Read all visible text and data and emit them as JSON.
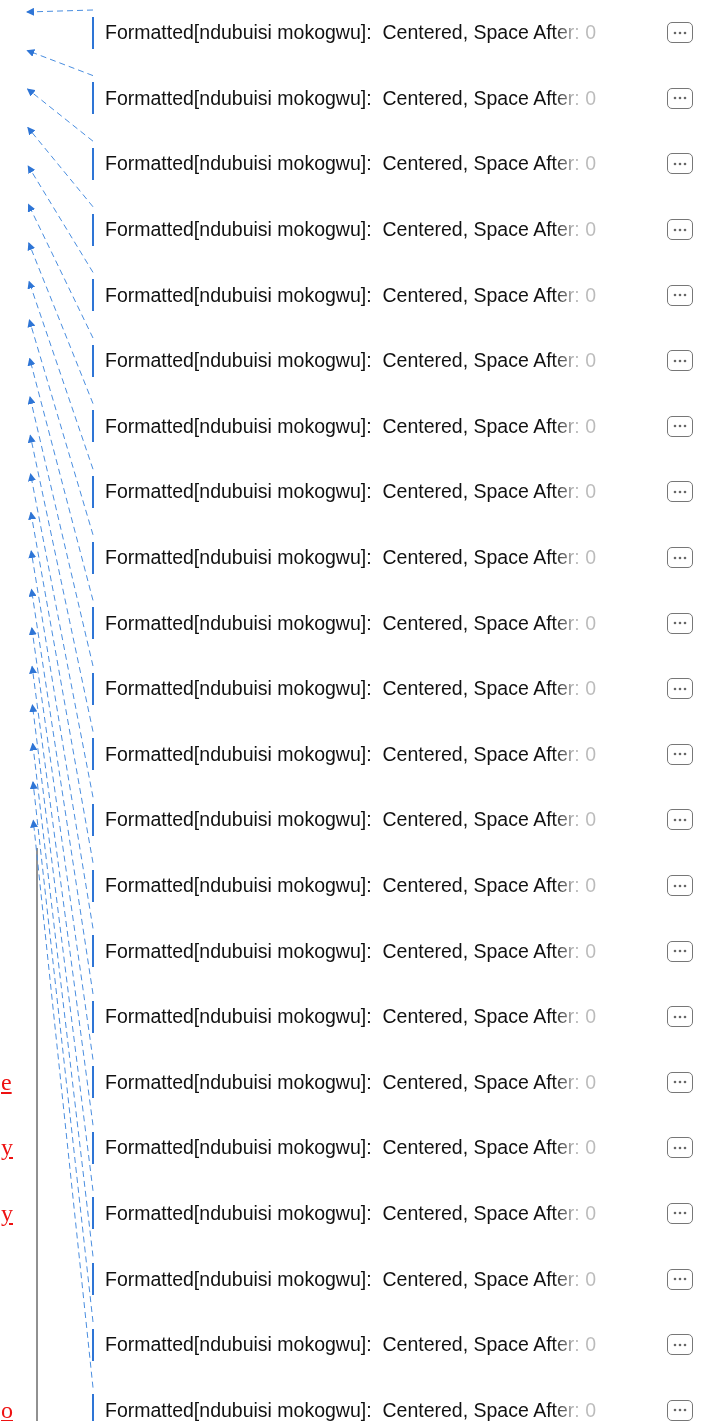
{
  "comments": [
    {
      "label": "Formatted[ndubuisi mokogwu]:",
      "detail": "Centered, Space After: 0"
    },
    {
      "label": "Formatted[ndubuisi mokogwu]:",
      "detail": "Centered, Space After: 0"
    },
    {
      "label": "Formatted[ndubuisi mokogwu]:",
      "detail": "Centered, Space After: 0"
    },
    {
      "label": "Formatted[ndubuisi mokogwu]:",
      "detail": "Centered, Space After: 0"
    },
    {
      "label": "Formatted[ndubuisi mokogwu]:",
      "detail": "Centered, Space After: 0"
    },
    {
      "label": "Formatted[ndubuisi mokogwu]:",
      "detail": "Centered, Space After: 0"
    },
    {
      "label": "Formatted[ndubuisi mokogwu]:",
      "detail": "Centered, Space After: 0"
    },
    {
      "label": "Formatted[ndubuisi mokogwu]:",
      "detail": "Centered, Space After: 0"
    },
    {
      "label": "Formatted[ndubuisi mokogwu]:",
      "detail": "Centered, Space After: 0"
    },
    {
      "label": "Formatted[ndubuisi mokogwu]:",
      "detail": "Centered, Space After: 0"
    },
    {
      "label": "Formatted[ndubuisi mokogwu]:",
      "detail": "Centered, Space After: 0"
    },
    {
      "label": "Formatted[ndubuisi mokogwu]:",
      "detail": "Centered, Space After: 0"
    },
    {
      "label": "Formatted[ndubuisi mokogwu]:",
      "detail": "Centered, Space After: 0"
    },
    {
      "label": "Formatted[ndubuisi mokogwu]:",
      "detail": "Centered, Space After: 0"
    },
    {
      "label": "Formatted[ndubuisi mokogwu]:",
      "detail": "Centered, Space After: 0"
    },
    {
      "label": "Formatted[ndubuisi mokogwu]:",
      "detail": "Centered, Space After: 0"
    },
    {
      "label": "Formatted[ndubuisi mokogwu]:",
      "detail": "Centered, Space After: 0",
      "document_text": "e"
    },
    {
      "label": "Formatted[ndubuisi mokogwu]:",
      "detail": "Centered, Space After: 0",
      "document_text": "y"
    },
    {
      "label": "Formatted[ndubuisi mokogwu]:",
      "detail": "Centered, Space After: 0",
      "document_text": "y"
    },
    {
      "label": "Formatted[ndubuisi mokogwu]:",
      "detail": "Centered, Space After: 0"
    },
    {
      "label": "Formatted[ndubuisi mokogwu]:",
      "detail": "Centered, Space After: 0"
    },
    {
      "label": "Formatted[ndubuisi mokogwu]:",
      "detail": "Centered, Space After: 0",
      "document_text": "o"
    }
  ]
}
